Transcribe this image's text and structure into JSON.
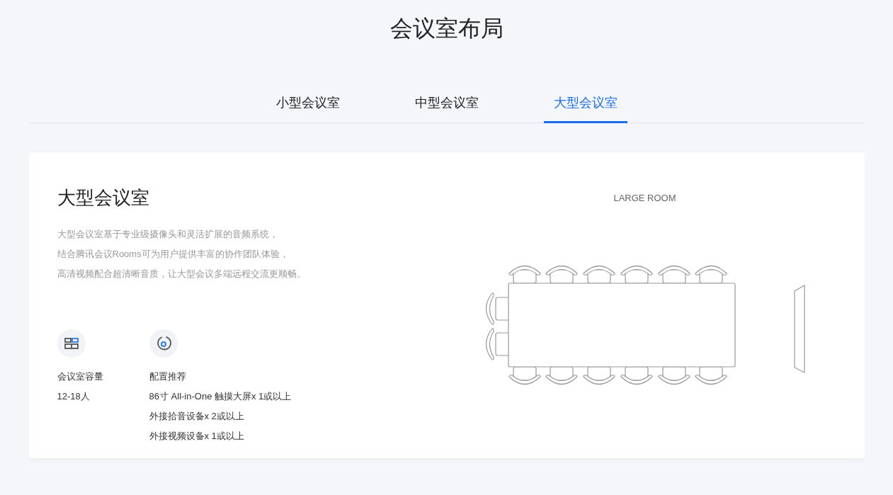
{
  "page_title": "会议室布局",
  "tabs": [
    {
      "label": "小型会议室",
      "selected": false
    },
    {
      "label": "中型会议室",
      "selected": false
    },
    {
      "label": "大型会议室",
      "selected": true
    }
  ],
  "card": {
    "title": "大型会议室",
    "description": [
      "大型会议室基于专业级摄像头和灵活扩展的音频系统，",
      "结合腾讯会议Rooms可为用户提供丰富的协作团队体验，",
      "高清视频配合超清晰音质，让大型会议多端远程交流更顺畅。"
    ],
    "specs": [
      {
        "kind": "capacity",
        "label": "会议室容量",
        "lines": [
          "12-18人"
        ]
      },
      {
        "kind": "config",
        "label": "配置推荐",
        "lines": [
          "86寸 All-in-One 触摸大屏x 1或以上",
          "外接拾音设备x 2或以上",
          "外接视频设备x 1或以上"
        ]
      }
    ],
    "diagram_label": "LARGE ROOM"
  }
}
